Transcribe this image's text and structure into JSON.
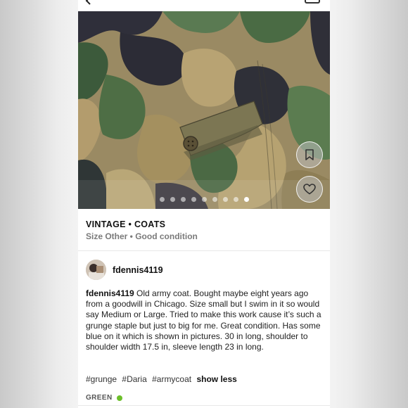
{
  "listing": {
    "category": "VINTAGE • COATS",
    "meta": "Size Other • Good condition",
    "photo_count": 9,
    "active_photo_index": 8
  },
  "seller": {
    "username": "fdennis4119"
  },
  "description": {
    "author": "fdennis4119",
    "text": " Old army coat. Bought maybe eight years ago from a goodwill in Chicago. Size small but I swim in it so would say Medium or Large. Tried to make this work cause it’s such a grunge staple but just to big for me. Great condition. Has some blue on it which is shown in pictures. 30 in long, shoulder to shoulder width 17.5 in, sleeve length 23 in long."
  },
  "tags": [
    "#grunge",
    "#Daria",
    "#armycoat"
  ],
  "show_less_label": "show less",
  "color": {
    "label": "GREEN",
    "swatch": "#6cbf2a"
  },
  "icons": {
    "back": "chevron-left-icon",
    "share": "square-icon",
    "bookmark": "bookmark-icon",
    "like": "heart-icon"
  }
}
